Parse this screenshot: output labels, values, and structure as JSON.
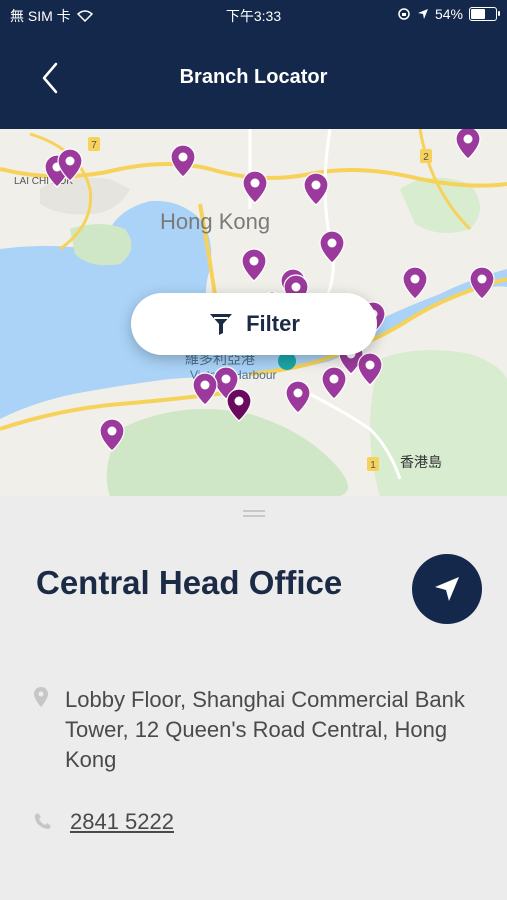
{
  "status_bar": {
    "carrier": "無 SIM 卡",
    "time": "下午3:33",
    "battery": "54%"
  },
  "header": {
    "title": "Branch Locator"
  },
  "map": {
    "filter_label": "Filter",
    "labels": {
      "lai_chi_kok": "LAI CHI KOK",
      "hong_kong": "Hong Kong",
      "harbour_cn": "維多利亞港",
      "harbour_en": "Victoria Harbour",
      "island_cn": "香港島"
    }
  },
  "branch": {
    "name": "Central Head Office",
    "address": "Lobby Floor, Shanghai Commercial Bank Tower, 12 Queen's Road Central, Hong Kong",
    "phone": "2841 5222"
  },
  "colors": {
    "header": "#14284b",
    "pin": "#9b3a9c",
    "pin_selected": "#6a0a5f"
  }
}
